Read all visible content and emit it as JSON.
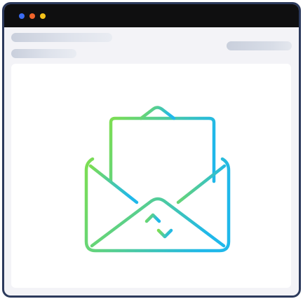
{
  "window": {
    "frame_color": "#2c3a5c",
    "titlebar_color": "#0f0f10",
    "background_color": "#f3f3f7",
    "controls": [
      {
        "name": "close",
        "color": "#3b6cf0"
      },
      {
        "name": "minimize",
        "color": "#f0642a"
      },
      {
        "name": "maximize",
        "color": "#f4c21a"
      }
    ]
  },
  "main": {
    "icon": "mail-exchange-icon",
    "icon_gradient": {
      "start": "#7dde52",
      "end": "#20b8ea"
    }
  }
}
